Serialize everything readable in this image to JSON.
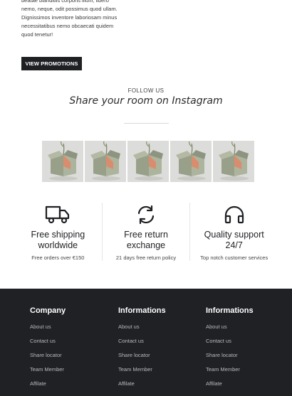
{
  "promo": {
    "text": "beatae blanditiis corporis illum, libero nemo, neque, odit possimus quod ullam. Dignissimos inventore laboriosam minus necessitatibus nemo obcaecati quidem quod tenetur!",
    "button": "VIEW PROMOTIONS"
  },
  "instagram": {
    "follow_label": "FOLLOW US",
    "title": "Share your room on Instagram",
    "photos": [
      "photo-1",
      "photo-2",
      "photo-3",
      "photo-4",
      "photo-5"
    ]
  },
  "features": [
    {
      "icon": "truck-icon",
      "title": "Free shipping worldwide",
      "sub": "Free orders over €150"
    },
    {
      "icon": "refresh-icon",
      "title": "Free return exchange",
      "sub": "21 days free return policy"
    },
    {
      "icon": "headphones-icon",
      "title": "Quality support 24/7",
      "sub": "Top notch customer services"
    }
  ],
  "footer": {
    "columns": [
      {
        "title": "Company",
        "links": [
          "About us",
          "Contact us",
          "Share locator",
          "Team Member",
          "Affilate"
        ]
      },
      {
        "title": "Informations",
        "links": [
          "About us",
          "Contact us",
          "Share locator",
          "Team Member",
          "Affilate"
        ]
      },
      {
        "title": "Informations",
        "links": [
          "About us",
          "Contact us",
          "Share locator",
          "Team Member",
          "Affilate"
        ]
      }
    ]
  }
}
